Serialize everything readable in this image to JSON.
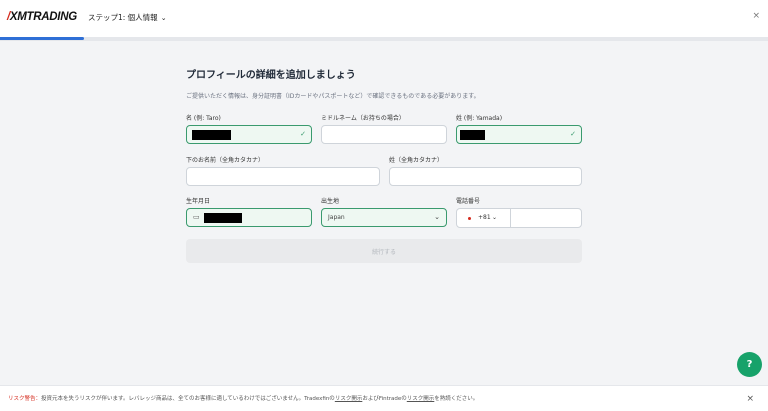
{
  "header": {
    "logo_slash": "/",
    "logo_text": "XMTRADING",
    "step_label": "ステップ1: 個人情報",
    "step_chevron": "⌄",
    "close": "×",
    "progress": 0.11
  },
  "form": {
    "title": "プロフィールの詳細を追加しましょう",
    "subtitle": "ご提供いただく情報は、身分証明書（IDカードやパスポートなど）で確認できるものである必要があります。",
    "first_name": {
      "label": "名 (例: Taro)",
      "status": "valid"
    },
    "middle_name": {
      "label": "ミドルネーム（お持ちの場合）"
    },
    "last_name": {
      "label": "姓 (例: Yamada)",
      "status": "valid"
    },
    "first_name_kana": {
      "label": "下のお名前（全角カタカナ）"
    },
    "last_name_kana": {
      "label": "姓（全角カタカナ）"
    },
    "birth_date": {
      "label": "生年月日",
      "status": "valid"
    },
    "birth_place": {
      "label": "出生地",
      "value": "Japan"
    },
    "phone": {
      "label": "電話番号",
      "country_code": "+81"
    },
    "continue_label": "続行する"
  },
  "chat": {
    "icon": "?"
  },
  "footer": {
    "risk_label": "リスク警告：",
    "risk_text_1": "投資元本を失うリスクが伴います。レバレッジ商品は、全てのお客様に適しているわけではございません。Tradexfinの",
    "risk_link_1": "リスク開示",
    "risk_text_2": "およびFintradeの",
    "risk_link_2": "リスク開示",
    "risk_text_3": "を熟読ください。",
    "close": "×"
  }
}
